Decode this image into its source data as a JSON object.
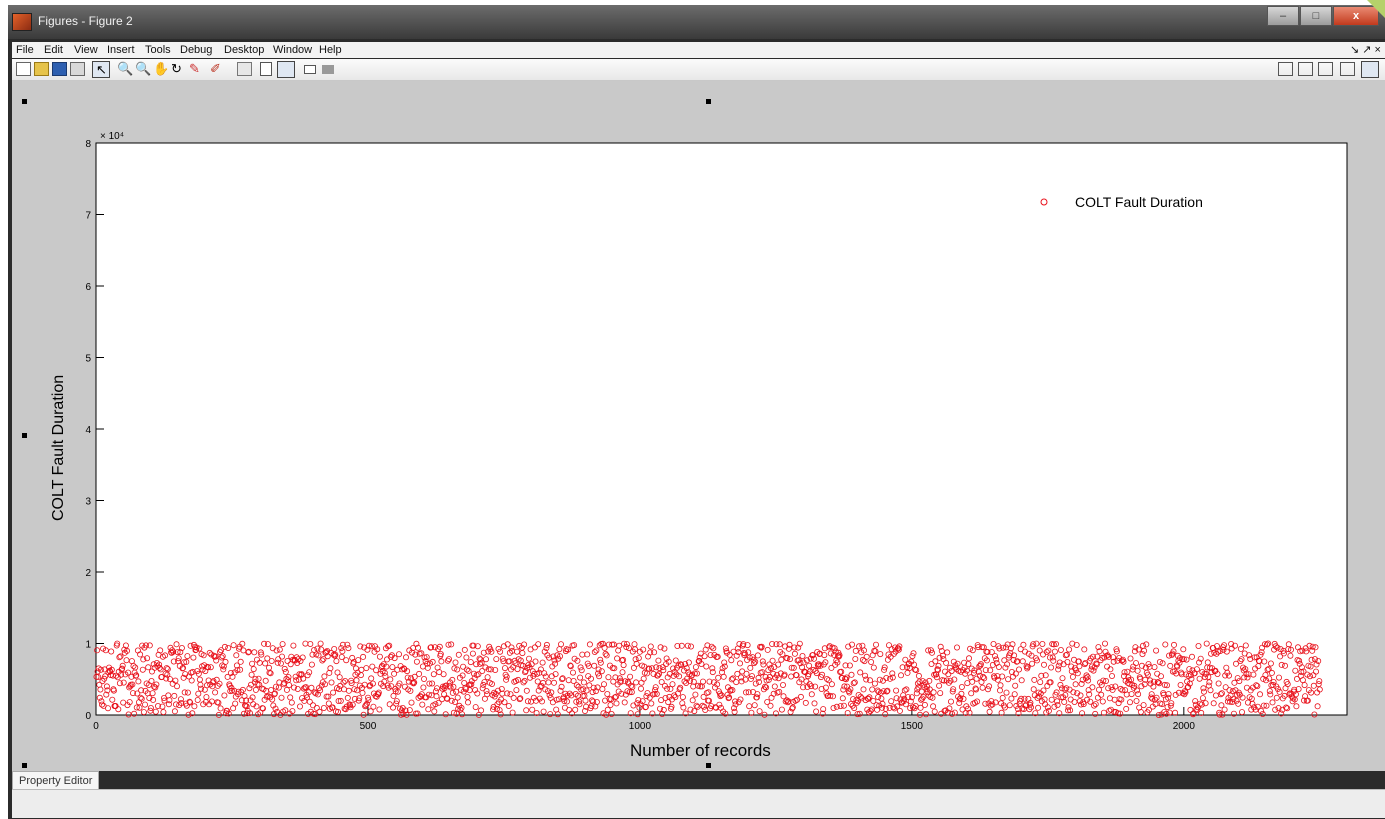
{
  "window": {
    "title": "Figures - Figure 2"
  },
  "window_controls": [
    "–",
    "□",
    "x"
  ],
  "menu": [
    "File",
    "Edit",
    "View",
    "Insert",
    "Tools",
    "Debug",
    "Desktop",
    "Window",
    "Help"
  ],
  "dock_arrows": "↘ ↗ ×",
  "toolbar": {
    "buttons": [
      "new-figure-icon",
      "open-file-icon",
      "save-icon",
      "print-icon",
      "edit-plot-icon",
      "zoom-in-icon",
      "zoom-out-icon",
      "pan-icon",
      "rotate-3d-icon",
      "data-cursor-icon",
      "brush-icon",
      "link-plot-icon",
      "colorbar-icon",
      "legend-icon",
      "hide-plot-tools-icon",
      "show-plot-tools-icon"
    ],
    "layout_buttons": [
      "tile-icon",
      "side-by-side-icon",
      "stacked-icon",
      "float-icon",
      "maximize-icon"
    ]
  },
  "bottom": {
    "property_editor_tab": "Property Editor"
  },
  "colors": {
    "marker": "#e8101a",
    "figure_bg": "#c9c9c9",
    "axes_bg": "#ffffff"
  },
  "chart_data": {
    "type": "scatter",
    "xlabel": "Number of records",
    "ylabel": "COLT Fault Duration",
    "y_exponent": "× 10⁴",
    "xlim": [
      0,
      2300
    ],
    "ylim": [
      0,
      8
    ],
    "xticks": [
      0,
      500,
      1000,
      1500,
      2000
    ],
    "yticks": [
      0,
      1,
      2,
      3,
      4,
      5,
      6,
      7,
      8
    ],
    "legend": {
      "label": "COLT Fault Duration",
      "location": "top-right"
    },
    "series": [
      {
        "name": "COLT Fault Duration",
        "marker": "circle",
        "color": "#e8101a",
        "n_points": 2250,
        "y_range": [
          0,
          1.0
        ]
      }
    ]
  }
}
